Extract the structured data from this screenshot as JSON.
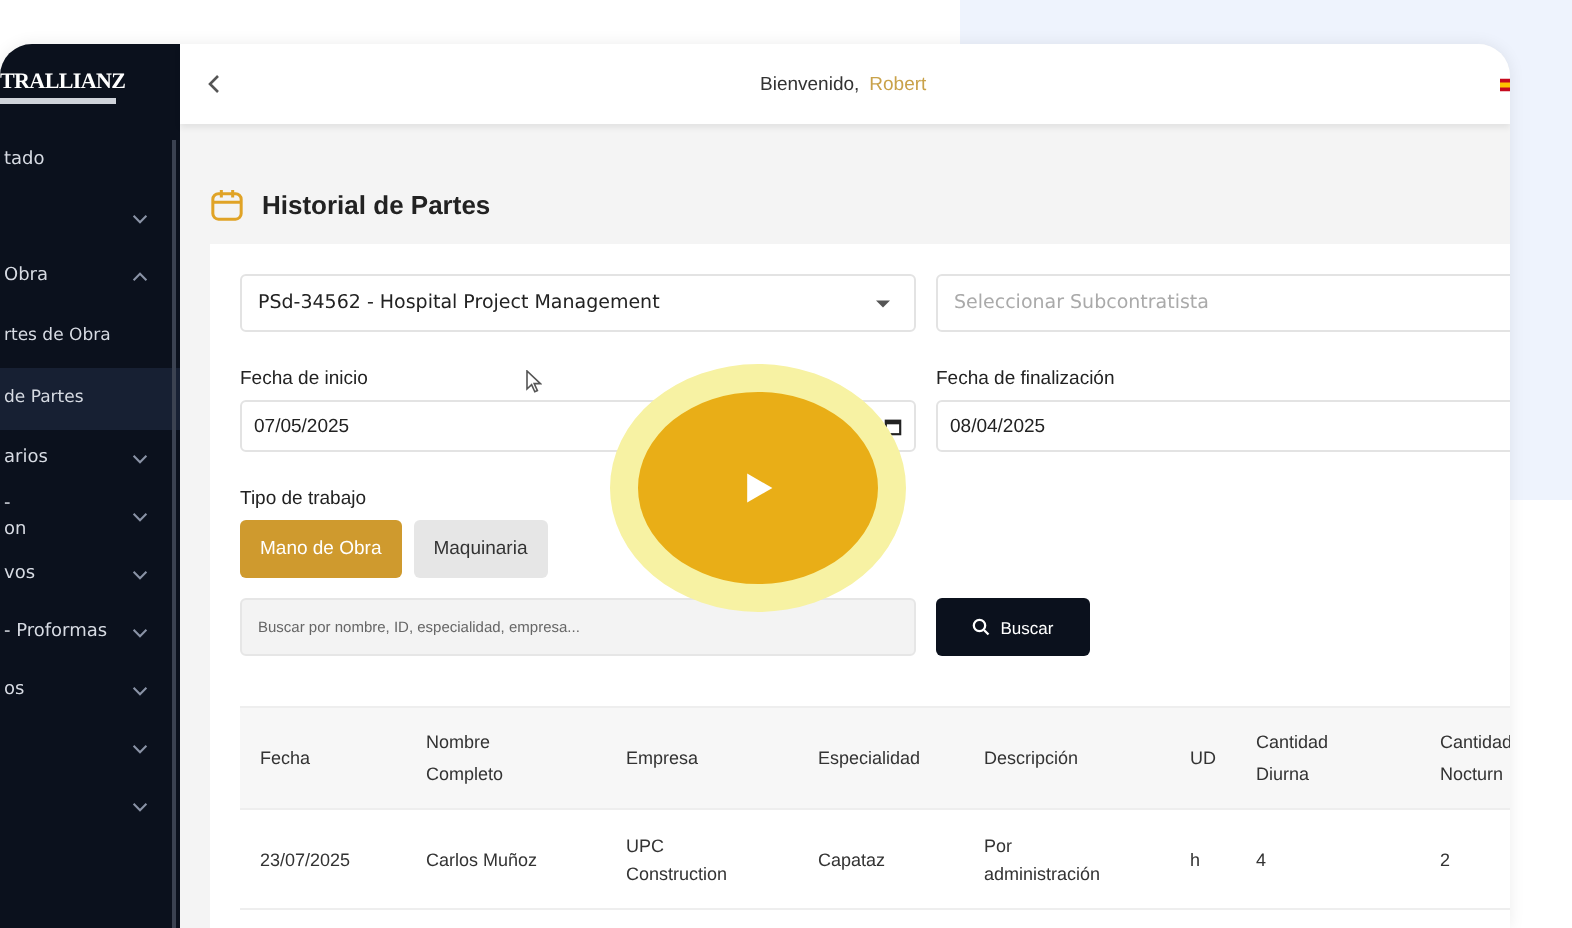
{
  "sidebar": {
    "logo": "TRALLIANZ",
    "items": [
      {
        "kind": "link",
        "label": "tado",
        "selected": false
      },
      {
        "kind": "group",
        "expanded": false,
        "selected": false
      },
      {
        "kind": "group",
        "label": "Obra",
        "expanded": true,
        "selected": false,
        "children": [
          {
            "label": "rtes de Obra",
            "selected": false
          },
          {
            "label": "de Partes",
            "selected": true
          }
        ]
      },
      {
        "kind": "group",
        "label": "arios",
        "expanded": false,
        "selected": false
      },
      {
        "kind": "group",
        "label": "-\non",
        "expanded": false,
        "selected": false
      },
      {
        "kind": "group",
        "label": "vos",
        "expanded": false,
        "selected": false
      },
      {
        "kind": "group",
        "label": "- Proformas",
        "expanded": false,
        "selected": false
      },
      {
        "kind": "group",
        "label": "os",
        "expanded": false,
        "selected": false
      },
      {
        "kind": "group",
        "expanded": false,
        "selected": false
      },
      {
        "kind": "group",
        "expanded": false,
        "selected": false
      }
    ]
  },
  "header": {
    "greeting": "Bienvenido,",
    "user": "Robert"
  },
  "page": {
    "title": "Historial de Partes"
  },
  "filters": {
    "project": {
      "value": "PSd-34562 - Hospital Project Management"
    },
    "subcontractor": {
      "placeholder": "Seleccionar Subcontratista"
    },
    "start_date": {
      "label": "Fecha de inicio",
      "value": "07/05/2025"
    },
    "end_date": {
      "label": "Fecha de finalización",
      "value": "08/04/2025"
    },
    "work_type": {
      "label": "Tipo de trabajo",
      "options": [
        {
          "label": "Mano de Obra",
          "selected": true
        },
        {
          "label": "Maquinaria",
          "selected": false
        }
      ]
    },
    "search": {
      "placeholder": "Buscar por nombre, ID, especialidad, empresa..."
    },
    "search_button": "Buscar"
  },
  "table": {
    "columns": [
      "Fecha",
      "Nombre\nCompleto",
      "Empresa",
      "Especialidad",
      "Descripción",
      "UD",
      "Cantidad\nDiurna",
      "Cantidad\nNocturn"
    ],
    "rows": [
      [
        "23/07/2025",
        "Carlos Muñoz",
        "UPC\nConstruction",
        "Capataz",
        "Por\nadministración",
        "h",
        "4",
        "2"
      ]
    ]
  }
}
